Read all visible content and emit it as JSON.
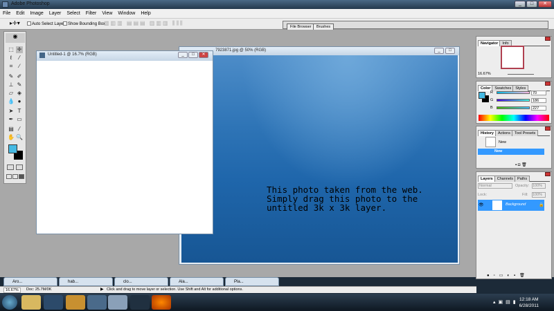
{
  "app": {
    "title": "Adobe Photoshop"
  },
  "menu": [
    "File",
    "Edit",
    "Image",
    "Layer",
    "Select",
    "Filter",
    "View",
    "Window",
    "Help"
  ],
  "options": {
    "auto_select": "Auto Select Layer",
    "bounding_box": "Show Bounding Box"
  },
  "well": {
    "tabs": [
      "File Browser",
      "Brushes"
    ]
  },
  "docs": {
    "untitled": {
      "title": "Untitled-1 @ 16.7% (RGB)"
    },
    "photo": {
      "title": "7923871.jpg @ 50% (RGB)",
      "overlay_text": "This photo taken from the web.\nSimply drag this photo to the\nuntitled 3k x 3k layer."
    }
  },
  "navigator": {
    "tabs": [
      "Navigator",
      "Info"
    ],
    "zoom": "16.67%"
  },
  "color": {
    "tabs": [
      "Color",
      "Swatches",
      "Styles"
    ],
    "r_label": "R",
    "g_label": "G",
    "b_label": "B",
    "r": "70",
    "g": "186",
    "b": "227",
    "foreground": "#46bae3",
    "background": "#000000"
  },
  "history": {
    "tabs": [
      "History",
      "Actions",
      "Tool Presets"
    ],
    "snapshot": "New",
    "state": "New"
  },
  "layers": {
    "tabs": [
      "Layers",
      "Channels",
      "Paths"
    ],
    "blend": "Normal",
    "opacity_label": "Opacity:",
    "opacity": "100%",
    "lock_label": "Lock:",
    "fill_label": "Fill:",
    "fill": "100%",
    "layer_name": "Background"
  },
  "minimized": [
    "Aro...",
    "hab...",
    "clo...",
    "Ala...",
    "Pla..."
  ],
  "status": {
    "zoom": "16.67%",
    "doc": "Doc: 25.7M/0K",
    "hint": "Click and drag to move layer or selection. Use Shift and Alt for additional options."
  },
  "clock": {
    "time": "12:18 AM",
    "date": "6/28/2011"
  }
}
